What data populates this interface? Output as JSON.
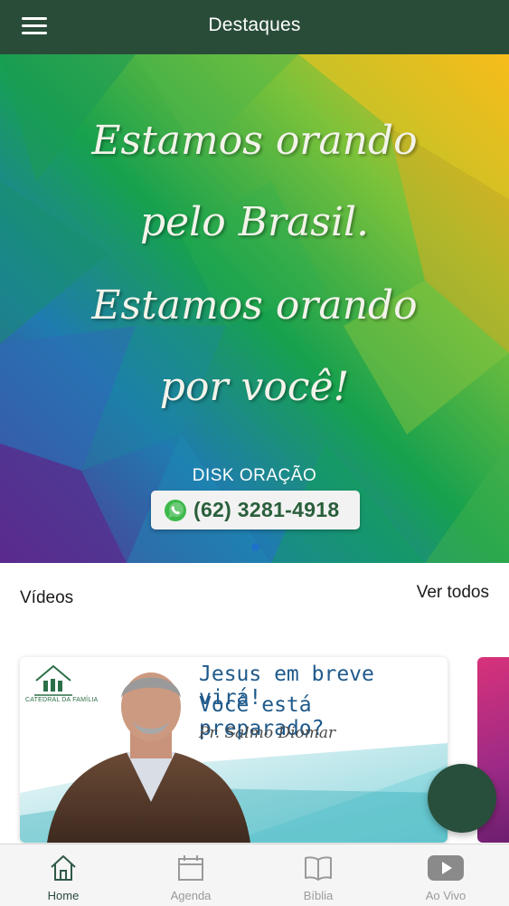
{
  "header": {
    "title": "Destaques",
    "menu_icon": "hamburger-menu-icon"
  },
  "banner": {
    "lines": [
      "Estamos orando",
      "pelo Brasil.",
      "Estamos orando",
      "por você!"
    ],
    "disk_label": "DISK ORAÇÃO",
    "phone": "(62) 3281-4918",
    "phone_icon": "whatsapp-icon"
  },
  "videos": {
    "title": "Vídeos",
    "see_all": "Ver todos",
    "cards": [
      {
        "logo_text": "CATEDRAL DA FAMÍLIA",
        "title_line1": "Jesus em breve virá!",
        "title_line2": "Você está preparado?",
        "author": "Pr. Salmo Diomar"
      }
    ]
  },
  "bottom_nav": {
    "items": [
      {
        "label": "Home",
        "icon": "home-icon",
        "active": true
      },
      {
        "label": "Agenda",
        "icon": "calendar-icon",
        "active": false
      },
      {
        "label": "Bíblia",
        "icon": "book-icon",
        "active": false
      },
      {
        "label": "Ao Vivo",
        "icon": "play-video-icon",
        "active": false
      }
    ]
  },
  "colors": {
    "header_bg": "#294c39",
    "accent": "#284f3b",
    "nav_bg": "#f5f5f5"
  }
}
